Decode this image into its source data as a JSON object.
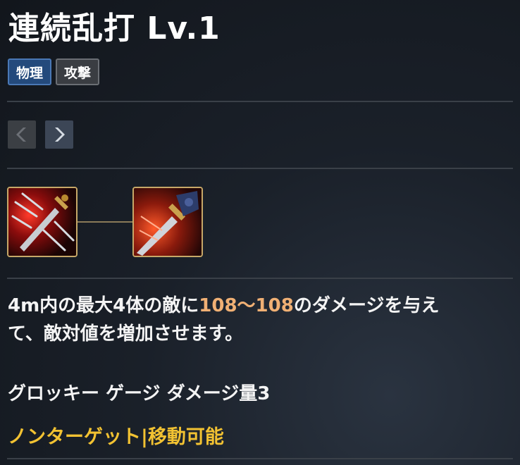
{
  "skill": {
    "title": "連続乱打 Lv.1",
    "tags": [
      "物理",
      "攻撃"
    ],
    "description_prefix": "4m内の最大4体の敵に",
    "description_damage": "108〜108",
    "description_suffix": "のダメージを与え",
    "description_line2": "て、敵対値を増加させます。",
    "groggy_text": "グロッキー ゲージ ダメージ量3",
    "properties_text": "ノンターゲット|移動可能"
  },
  "navigation": {
    "prev_icon": "chevron-left-icon",
    "next_icon": "chevron-right-icon"
  },
  "colors": {
    "damage_highlight": "#f0b074",
    "property_text": "#f2c232",
    "physical_tag_bg": "#244a7c",
    "attack_tag_bg": "#3a3d42",
    "icon_border": "#c7a868"
  }
}
